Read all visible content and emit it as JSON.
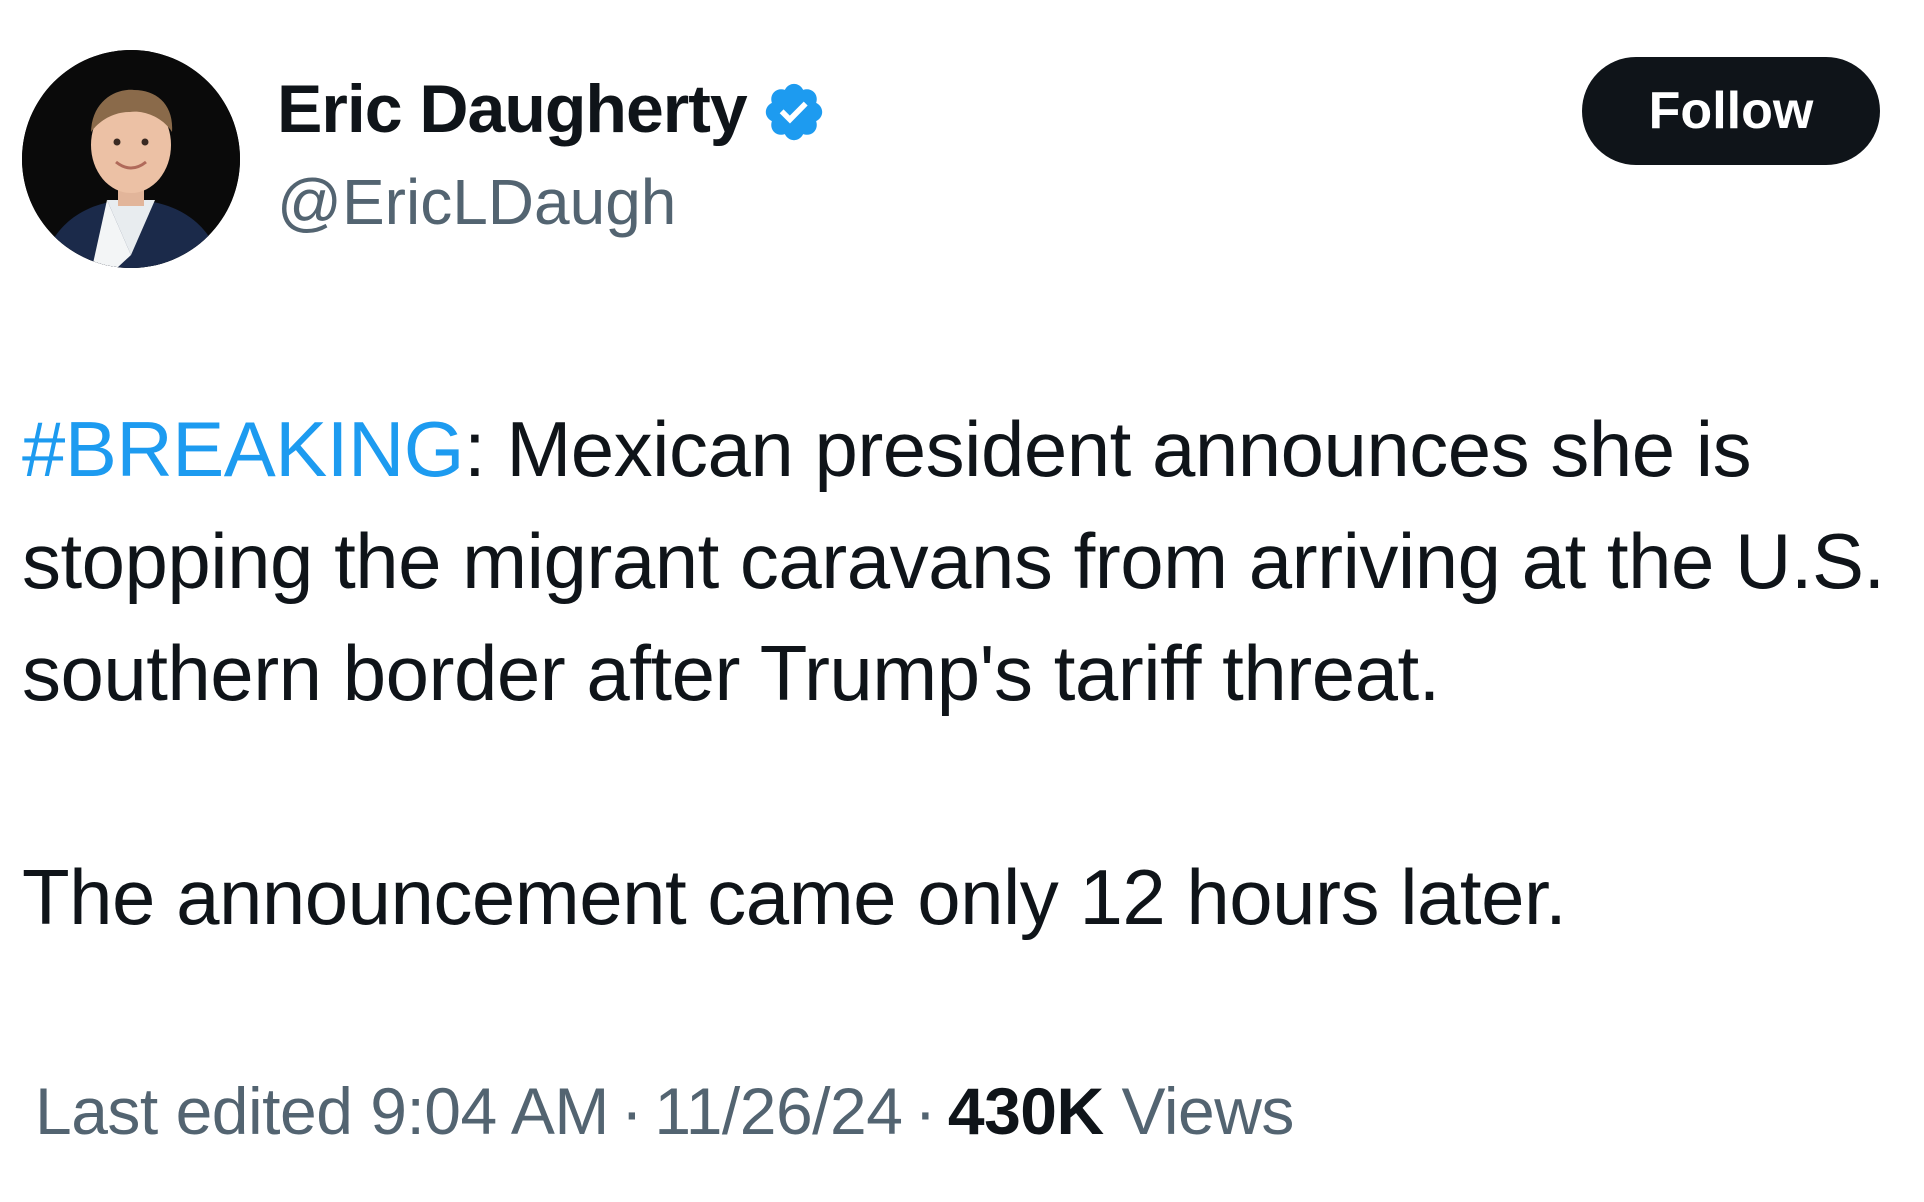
{
  "author": {
    "display_name": "Eric Daugherty",
    "handle": "@EricLDaugh",
    "verified": true
  },
  "follow_button": {
    "label": "Follow"
  },
  "tweet": {
    "hashtag": "#BREAKING",
    "line1_rest": ": Mexican president announces she is stopping the migrant caravans from arriving at the U.S. southern border after Trump's tariff threat.",
    "paragraph2": "The announcement came only 12 hours later."
  },
  "meta": {
    "edited_label": "Last edited 9:04 AM",
    "date": "11/26/24",
    "views_count": "430K",
    "views_label": "Views",
    "separator": "·"
  },
  "colors": {
    "text": "#0f1419",
    "secondary": "#536471",
    "accent": "#1d9bf0",
    "button_bg": "#0f1419"
  }
}
